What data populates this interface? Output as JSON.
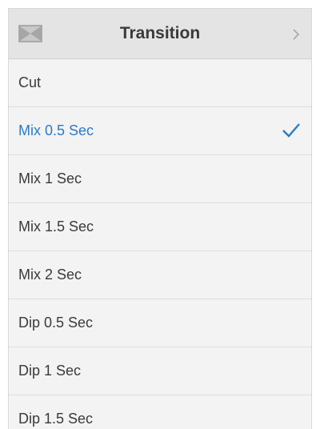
{
  "header": {
    "title": "Transition",
    "left_icon": "transition-icon",
    "right_icon": "chevron-right-icon"
  },
  "items": [
    {
      "label": "Cut",
      "selected": false
    },
    {
      "label": "Mix 0.5 Sec",
      "selected": true
    },
    {
      "label": "Mix 1 Sec",
      "selected": false
    },
    {
      "label": "Mix 1.5 Sec",
      "selected": false
    },
    {
      "label": "Mix 2 Sec",
      "selected": false
    },
    {
      "label": "Dip 0.5 Sec",
      "selected": false
    },
    {
      "label": "Dip 1 Sec",
      "selected": false
    },
    {
      "label": "Dip 1.5 Sec",
      "selected": false
    }
  ],
  "colors": {
    "accent": "#2b7ac7",
    "text": "#3a3a3a",
    "header_bg": "#e4e4e4",
    "list_bg": "#f3f3f3"
  },
  "selected_icon": "checkmark-icon"
}
